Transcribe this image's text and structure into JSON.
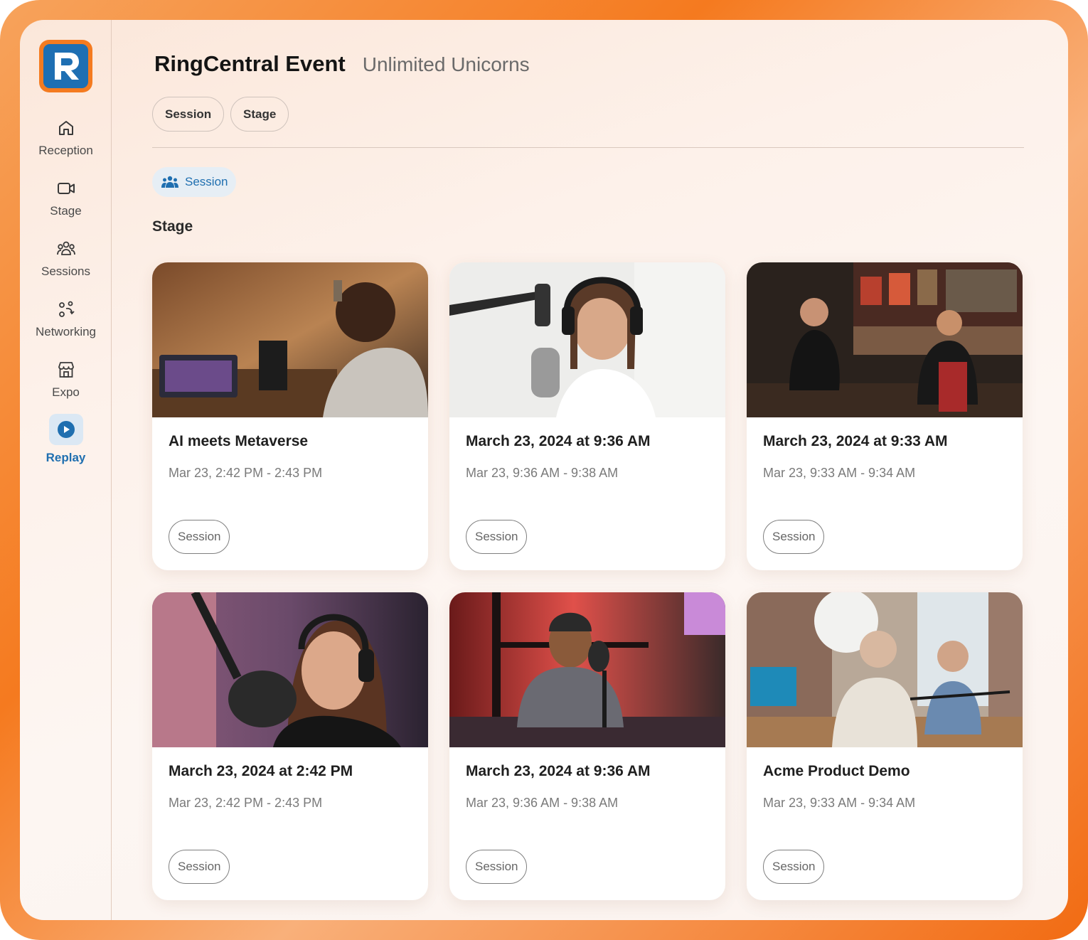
{
  "app": {
    "title": "RingCentral Event",
    "subtitle": "Unlimited Unicorns"
  },
  "sidebar": {
    "items": [
      {
        "label": "Reception",
        "icon": "home-icon",
        "active": false
      },
      {
        "label": "Stage",
        "icon": "video-camera-icon",
        "active": false
      },
      {
        "label": "Sessions",
        "icon": "group-icon",
        "active": false
      },
      {
        "label": "Networking",
        "icon": "networking-icon",
        "active": false
      },
      {
        "label": "Expo",
        "icon": "storefront-icon",
        "active": false
      },
      {
        "label": "Replay",
        "icon": "play-circle-icon",
        "active": true
      }
    ]
  },
  "filters": {
    "pills": [
      "Session",
      "Stage"
    ],
    "active_chip": "Session"
  },
  "section": {
    "heading": "Stage"
  },
  "cards": [
    {
      "title": "AI meets Metaverse",
      "time": "Mar 23, 2:42 PM - 2:43 PM",
      "tag": "Session"
    },
    {
      "title": "March 23, 2024 at 9:36 AM",
      "time": "Mar 23, 9:36 AM - 9:38 AM",
      "tag": "Session"
    },
    {
      "title": "March 23, 2024 at 9:33 AM",
      "time": "Mar 23, 9:33 AM - 9:34 AM",
      "tag": "Session"
    },
    {
      "title": "March 23, 2024 at 2:42 PM",
      "time": "Mar 23, 2:42 PM - 2:43 PM",
      "tag": "Session"
    },
    {
      "title": "March 23, 2024 at 9:36 AM",
      "time": "Mar 23, 9:36 AM - 9:38 AM",
      "tag": "Session"
    },
    {
      "title": "Acme Product Demo",
      "time": "Mar 23, 9:33 AM - 9:34 AM",
      "tag": "Session"
    }
  ],
  "colors": {
    "brand_orange": "#f47b20",
    "brand_blue": "#1e6fb3",
    "active_text": "#1f6fb0"
  }
}
